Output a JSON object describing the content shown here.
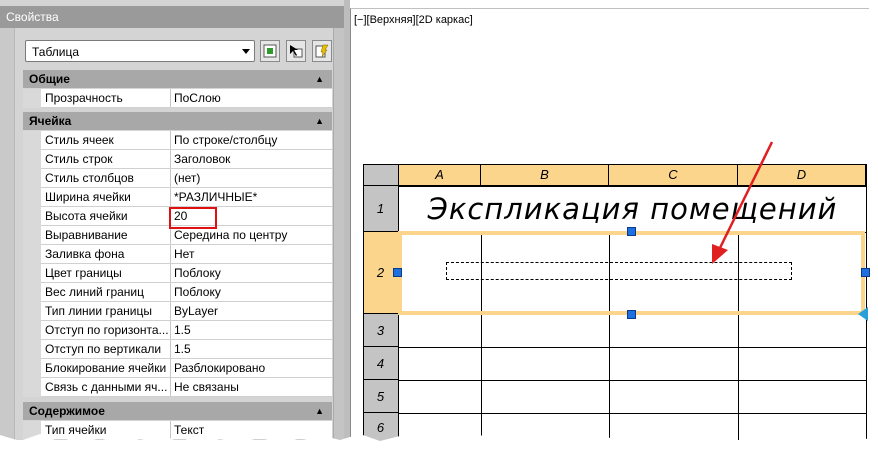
{
  "palette": {
    "title": "Свойства",
    "type_select": "Таблица",
    "sections": [
      {
        "label": "Общие",
        "rows": [
          {
            "name": "Прозрачность",
            "value": "ПоСлою"
          }
        ]
      },
      {
        "label": "Ячейка",
        "rows": [
          {
            "name": "Стиль ячеек",
            "value": "По строке/столбцу"
          },
          {
            "name": "Стиль строк",
            "value": "Заголовок"
          },
          {
            "name": "Стиль столбцов",
            "value": "(нет)"
          },
          {
            "name": "Ширина ячейки",
            "value": "*РАЗЛИЧНЫЕ*"
          },
          {
            "name": "Высота ячейки",
            "value": "20"
          },
          {
            "name": "Выравнивание",
            "value": "Середина по центру"
          },
          {
            "name": "Заливка фона",
            "value": "Нет"
          },
          {
            "name": "Цвет границы",
            "value": "Поблоку"
          },
          {
            "name": "Вес линий границ",
            "value": "Поблоку"
          },
          {
            "name": "Тип линии границы",
            "value": "ByLayer"
          },
          {
            "name": "Отступ по горизонта...",
            "value": "1.5"
          },
          {
            "name": "Отступ по вертикали",
            "value": "1.5"
          },
          {
            "name": "Блокирование ячейки",
            "value": "Разблокировано"
          },
          {
            "name": "Связь с данными яч...",
            "value": "Не связаны"
          }
        ]
      },
      {
        "label": "Содержимое",
        "rows": [
          {
            "name": "Тип ячейки",
            "value": "Текст"
          }
        ]
      }
    ]
  },
  "viewport": {
    "label": "[−][Верхняя][2D каркас]",
    "columns": [
      "A",
      "B",
      "C",
      "D"
    ],
    "rows": [
      "1",
      "2",
      "3",
      "4",
      "5",
      "6"
    ],
    "title_cell": "Экспликация помещений"
  },
  "colors": {
    "header_fill": "#fbd58c",
    "grip": "#1e6fe0",
    "highlight": "#e01010",
    "arrow": "#e02020"
  }
}
